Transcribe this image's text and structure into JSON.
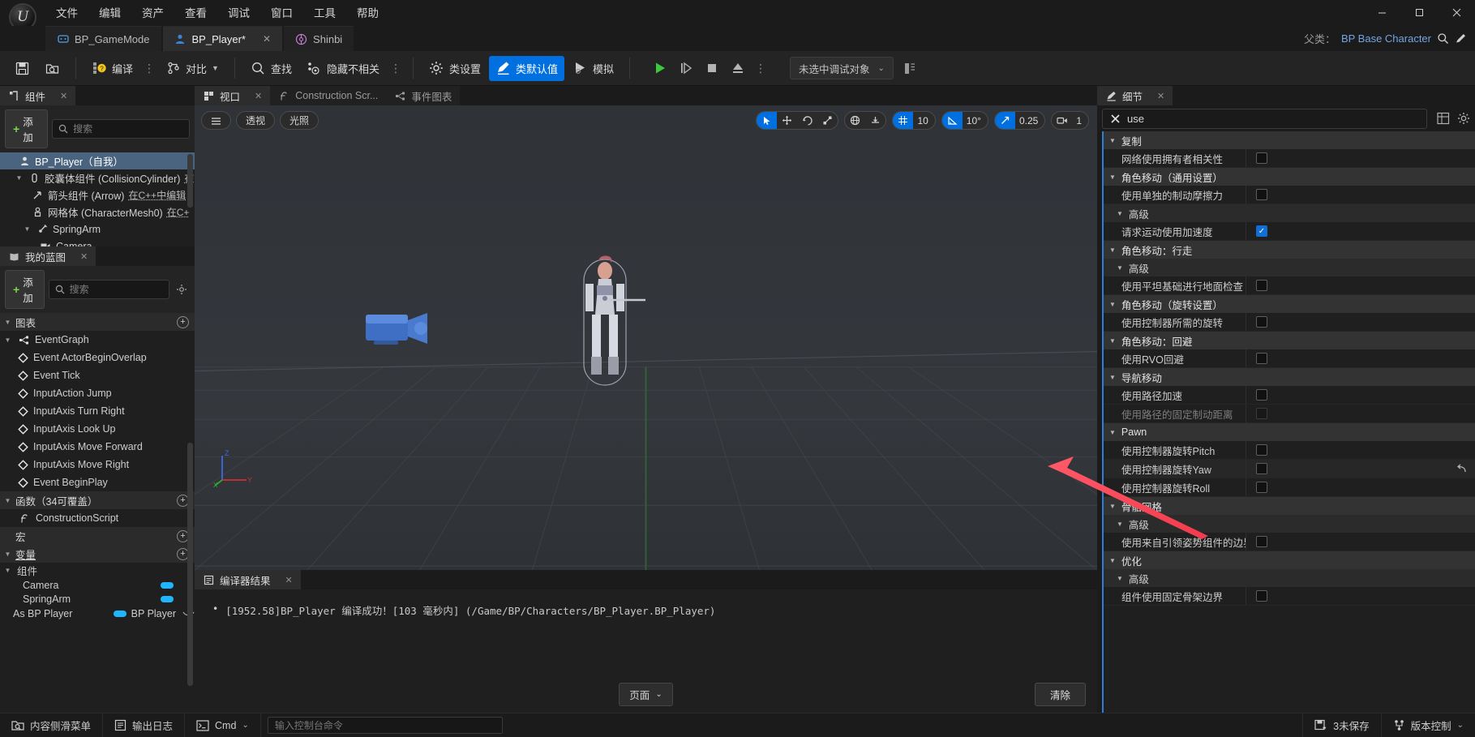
{
  "window": {
    "minimize": "—",
    "maximize": "▢",
    "close": "✕"
  },
  "menubar": {
    "items": [
      {
        "label": "文件"
      },
      {
        "label": "编辑"
      },
      {
        "label": "资产"
      },
      {
        "label": "查看"
      },
      {
        "label": "调试"
      },
      {
        "label": "窗口"
      },
      {
        "label": "工具"
      },
      {
        "label": "帮助"
      }
    ]
  },
  "tabs": {
    "items": [
      {
        "label": "BP_GameMode",
        "icon": "gamemode-icon",
        "active": false,
        "closable": false
      },
      {
        "label": "BP_Player*",
        "icon": "player-icon",
        "active": true,
        "closable": true
      },
      {
        "label": "Shinbi",
        "icon": "shinbi-icon",
        "active": false,
        "closable": false
      }
    ],
    "close_glyph": "✕"
  },
  "parent_class": {
    "label": "父类：",
    "value": "BP Base Character",
    "search_icon": "search-icon",
    "edit_icon": "pencil-icon"
  },
  "toolbar": {
    "save_icon": "save-icon",
    "browse_icon": "browse-content-icon",
    "compile_label": "编译",
    "diff_label": "对比",
    "find_label": "查找",
    "hide_unrelated_label": "隐藏不相关",
    "class_settings_label": "类设置",
    "class_defaults_label": "类默认值",
    "simulate_label": "模拟",
    "play_icon": "play-icon",
    "step_icon": "step-icon",
    "stop_icon": "stop-icon",
    "eject_icon": "eject-icon",
    "more_icon": "more-options-icon",
    "debug_object": "未选中调试对象",
    "debug_chevron": "⌄",
    "debug_extra_icon": "debug-filter-icon",
    "dots": "⋮"
  },
  "components_panel": {
    "tab_label": "组件",
    "tab_icon": "components-icon",
    "close_glyph": "✕",
    "add_label": "添加",
    "search_placeholder": "搜索",
    "tree": [
      {
        "label": "BP_Player（自我）",
        "icon": "pawn-icon",
        "indent": 0,
        "selected": true,
        "twisty": "",
        "suffix": ""
      },
      {
        "label": "胶囊体组件 (CollisionCylinder)",
        "icon": "capsule-icon",
        "indent": 1,
        "selected": false,
        "twisty": "▼",
        "suffix": "在"
      },
      {
        "label": "箭头组件 (Arrow)",
        "icon": "arrow-icon",
        "indent": 2,
        "selected": false,
        "twisty": "",
        "suffix": "在C++中编辑"
      },
      {
        "label": "网格体 (CharacterMesh0)",
        "icon": "mesh-icon",
        "indent": 2,
        "selected": false,
        "twisty": "",
        "suffix": "在C+"
      },
      {
        "label": "SpringArm",
        "icon": "springarm-icon",
        "indent": 1,
        "selected": false,
        "twisty": "▼",
        "suffix": ""
      },
      {
        "label": "Camera",
        "icon": "camera-icon",
        "indent": 2,
        "selected": false,
        "twisty": "",
        "suffix": ""
      }
    ]
  },
  "myblueprint_panel": {
    "tab_label": "我的蓝图",
    "tab_icon": "blueprint-icon",
    "close_glyph": "✕",
    "add_label": "添加",
    "search_placeholder": "搜索",
    "settings_icon": "gear-icon",
    "sections": [
      {
        "name": "graphs",
        "label": "图表",
        "add_glyph": "+",
        "items": [
          {
            "label": "EventGraph",
            "icon": "eventgraph-icon",
            "indent": 0,
            "twisty": "▼"
          }
        ]
      }
    ],
    "event_nodes": [
      {
        "label": "Event ActorBeginOverlap",
        "icon": "event-node-icon"
      },
      {
        "label": "Event Tick",
        "icon": "event-node-icon"
      },
      {
        "label": "InputAction Jump",
        "icon": "event-node-icon"
      },
      {
        "label": "InputAxis Turn Right",
        "icon": "event-node-icon"
      },
      {
        "label": "InputAxis Look Up",
        "icon": "event-node-icon"
      },
      {
        "label": "InputAxis Move Forward",
        "icon": "event-node-icon"
      },
      {
        "label": "InputAxis Move Right",
        "icon": "event-node-icon"
      },
      {
        "label": "Event BeginPlay",
        "icon": "event-node-icon"
      }
    ],
    "functions_section": {
      "label": "函数（34可覆盖）",
      "add_glyph": "+"
    },
    "functions_items": [
      {
        "label": "ConstructionScript",
        "icon": "function-icon"
      }
    ],
    "macros_section": {
      "label": "宏",
      "add_glyph": "+"
    },
    "variables_section": {
      "label": "变量",
      "add_glyph": "+"
    },
    "components_group": {
      "label": "组件",
      "twisty": "▼"
    },
    "variables": [
      {
        "label": "Camera",
        "type": "",
        "pill_color": "#1fb6ff"
      },
      {
        "label": "SpringArm",
        "type": "",
        "pill_color": "#1fb6ff"
      },
      {
        "label": "As BP Player",
        "type": "BP Player",
        "pill_color": "#1fb6ff",
        "eye_icon": "eye-closed-icon"
      }
    ]
  },
  "center": {
    "tabs": [
      {
        "label": "视口",
        "icon": "viewport-icon",
        "active": true,
        "closable": true
      },
      {
        "label": "Construction Scr...",
        "icon": "function-icon",
        "active": false,
        "closable": false
      },
      {
        "label": "事件图表",
        "icon": "eventgraph-icon",
        "active": false,
        "closable": false
      }
    ],
    "close_glyph": "✕",
    "viewport_left_buttons": [
      {
        "label": "",
        "icon": "menu-hamburger-icon"
      },
      {
        "label": "透视",
        "icon": ""
      },
      {
        "label": "光照",
        "icon": ""
      }
    ],
    "viewport_right": {
      "select_icon": "cursor-select-icon",
      "move_icon": "move-gizmo-icon",
      "rotate_icon": "rotate-gizmo-icon",
      "scale_icon": "scale-gizmo-icon",
      "world_icon": "world-space-icon",
      "snap_icon": "surface-snap-icon",
      "grid_icon": "grid-snap-icon",
      "grid_value": "10",
      "angle_icon": "angle-snap-icon",
      "angle_value": "10°",
      "scale_snap_icon": "scale-snap-icon",
      "scale_value": "0.25",
      "camera_icon": "camera-speed-icon",
      "camera_value": "1"
    },
    "axis_gizmo": {
      "z": "Z",
      "y": "Y",
      "x": "X"
    }
  },
  "results_panel": {
    "tab_label": "编译器结果",
    "tab_icon": "compiler-results-icon",
    "close_glyph": "✕",
    "messages": [
      {
        "bullet": "•",
        "text": "[1952.58]BP_Player 编译成功！[103 毫秒内] (/Game/BP/Characters/BP_Player.BP_Player)"
      }
    ],
    "page_label": "页面",
    "page_chevron": "⌄",
    "clear_label": "清除"
  },
  "details_panel": {
    "tab_label": "细节",
    "tab_icon": "details-icon",
    "close_glyph": "✕",
    "search_value": "use",
    "search_clear_icon": "clear-x-icon",
    "grid_view_icon": "grid-view-icon",
    "settings_icon": "gear-icon",
    "rows": [
      {
        "kind": "category",
        "label": "复制",
        "caret": "▼"
      },
      {
        "kind": "prop",
        "label": "网络使用拥有者相关性",
        "checked": false,
        "dim": false,
        "revert": false
      },
      {
        "kind": "category",
        "label": "角色移动（通用设置）",
        "caret": "▼"
      },
      {
        "kind": "prop",
        "label": "使用单独的制动摩擦力",
        "checked": false,
        "dim": false,
        "revert": false
      },
      {
        "kind": "subcategory",
        "label": "高级",
        "caret": "▼"
      },
      {
        "kind": "prop",
        "label": "请求运动使用加速度",
        "checked": true,
        "dim": false,
        "revert": false
      },
      {
        "kind": "category",
        "label": "角色移动：行走",
        "caret": "▼"
      },
      {
        "kind": "subcategory",
        "label": "高级",
        "caret": "▼"
      },
      {
        "kind": "prop",
        "label": "使用平坦基础进行地面检查",
        "checked": false,
        "dim": false,
        "revert": false
      },
      {
        "kind": "category",
        "label": "角色移动（旋转设置）",
        "caret": "▼"
      },
      {
        "kind": "prop",
        "label": "使用控制器所需的旋转",
        "checked": false,
        "dim": false,
        "revert": false
      },
      {
        "kind": "category",
        "label": "角色移动：回避",
        "caret": "▼"
      },
      {
        "kind": "prop",
        "label": "使用RVO回避",
        "checked": false,
        "dim": false,
        "revert": false
      },
      {
        "kind": "category",
        "label": "导航移动",
        "caret": "▼"
      },
      {
        "kind": "prop",
        "label": "使用路径加速",
        "checked": false,
        "dim": false,
        "revert": false
      },
      {
        "kind": "prop",
        "label": "使用路径的固定制动距离",
        "checked": false,
        "dim": true,
        "revert": false
      },
      {
        "kind": "category",
        "label": "Pawn",
        "caret": "▼"
      },
      {
        "kind": "prop",
        "label": "使用控制器旋转Pitch",
        "checked": false,
        "dim": false,
        "revert": false
      },
      {
        "kind": "prop",
        "label": "使用控制器旋转Yaw",
        "checked": false,
        "dim": false,
        "revert": true,
        "revert_icon": "revert-arrow-icon"
      },
      {
        "kind": "prop",
        "label": "使用控制器旋转Roll",
        "checked": false,
        "dim": false,
        "revert": false
      },
      {
        "kind": "category",
        "label": "骨骼网格",
        "caret": "▼"
      },
      {
        "kind": "subcategory",
        "label": "高级",
        "caret": "▼"
      },
      {
        "kind": "prop",
        "label": "使用来自引领姿势组件的边界",
        "checked": false,
        "dim": false,
        "revert": false
      },
      {
        "kind": "category",
        "label": "优化",
        "caret": "▼"
      },
      {
        "kind": "subcategory",
        "label": "高级",
        "caret": "▼"
      },
      {
        "kind": "prop",
        "label": "组件使用固定骨架边界",
        "checked": false,
        "dim": false,
        "revert": false
      }
    ]
  },
  "annotation": {
    "arrow_color": "#fa4a5a",
    "arrow_name": "red-pointer-arrow"
  },
  "statusbar": {
    "content_drawer_label": "内容侧滑菜单",
    "content_drawer_icon": "content-drawer-icon",
    "output_log_label": "输出日志",
    "output_log_icon": "output-log-icon",
    "cmd_label": "Cmd",
    "cmd_icon": "console-icon",
    "cmd_chevron": "⌄",
    "cmd_placeholder": "输入控制台命令",
    "unsaved_label": "3未保存",
    "unsaved_icon": "save-all-icon",
    "source_control_label": "版本控制",
    "source_control_icon": "source-control-icon",
    "source_control_chevron": "⌄"
  },
  "colors": {
    "accent_blue": "#0070e0",
    "selection_blue": "#4a6480",
    "link_blue": "#73a5e0",
    "green": "#7cd64a",
    "pill_cyan": "#1fb6ff",
    "arrow_red": "#fa4a5a"
  }
}
